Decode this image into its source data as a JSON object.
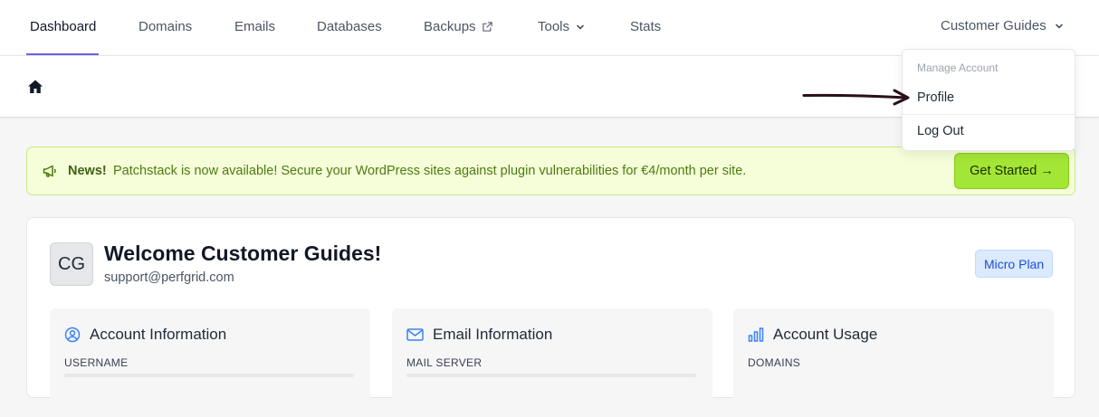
{
  "nav": {
    "items": [
      {
        "label": "Dashboard"
      },
      {
        "label": "Domains"
      },
      {
        "label": "Emails"
      },
      {
        "label": "Databases"
      },
      {
        "label": "Backups"
      },
      {
        "label": "Tools"
      },
      {
        "label": "Stats"
      }
    ],
    "active": "Dashboard",
    "user_menu": "Customer Guides"
  },
  "dropdown": {
    "header": "Manage Account",
    "items": [
      {
        "label": "Profile"
      },
      {
        "label": "Log Out"
      }
    ]
  },
  "news": {
    "title": "News!",
    "text": "Patchstack is now available! Secure your WordPress sites against plugin vulnerabilities for €4/month per site.",
    "button": "Get Started →"
  },
  "welcome": {
    "initials": "CG",
    "heading": "Welcome Customer Guides!",
    "email": "support@perfgrid.com",
    "plan": "Micro Plan"
  },
  "cards": [
    {
      "title": "Account Information",
      "label": "USERNAME",
      "icon": "user-circle-icon"
    },
    {
      "title": "Email Information",
      "label": "MAIL SERVER",
      "icon": "envelope-icon"
    },
    {
      "title": "Account Usage",
      "label": "DOMAINS",
      "icon": "bar-chart-icon"
    }
  ],
  "colors": {
    "accent": "#6d5ee8",
    "news_bg": "#f5fdd9",
    "news_button": "#a3e635",
    "plan_badge": "#dbeafe",
    "icon_blue": "#3b82f6"
  }
}
